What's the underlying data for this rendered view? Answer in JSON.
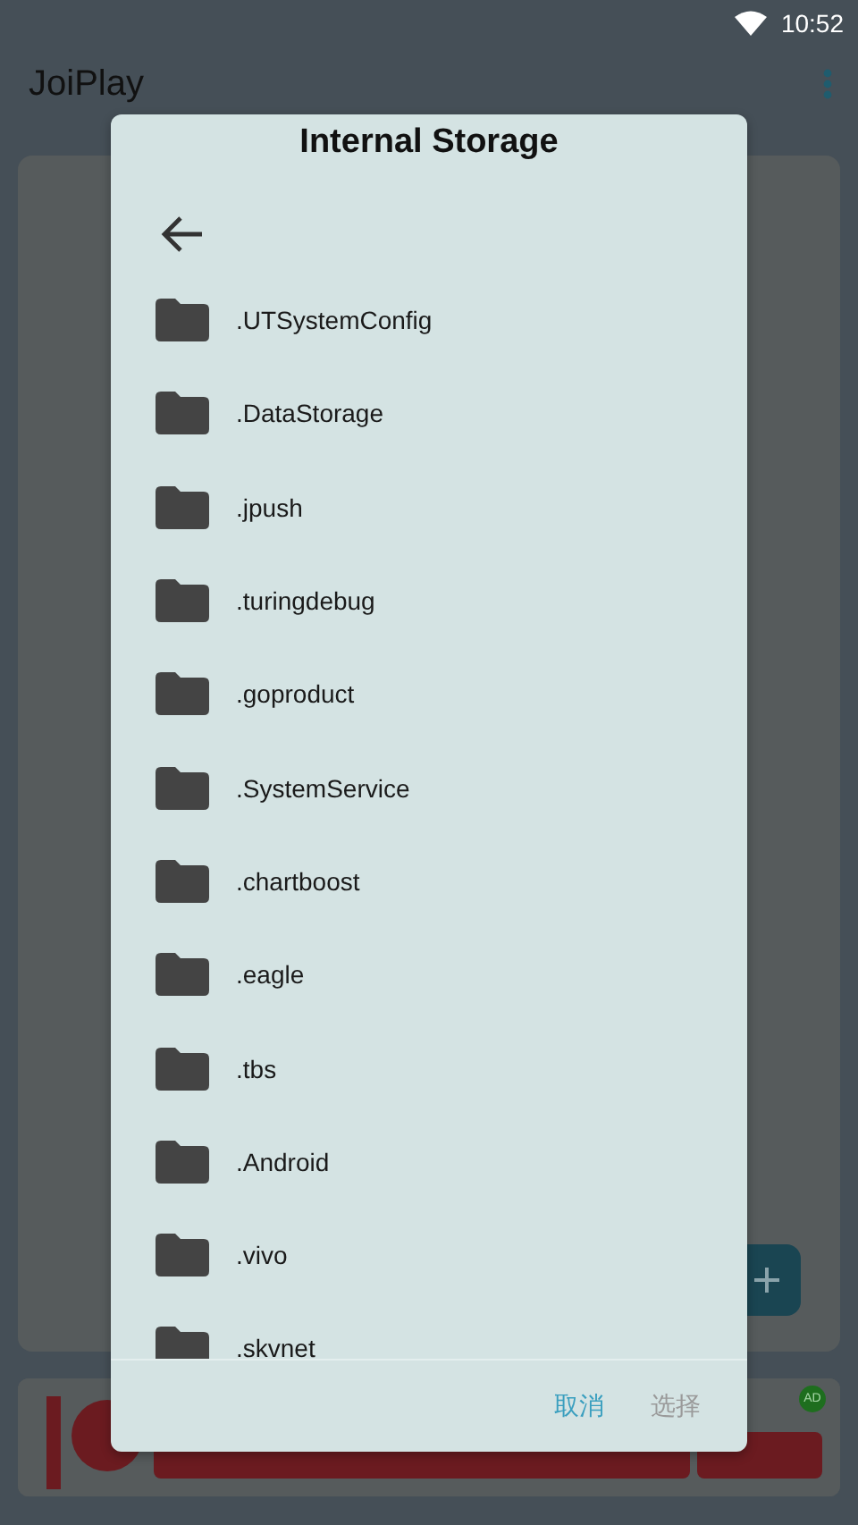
{
  "status_bar": {
    "time": "10:52"
  },
  "app_bar": {
    "title": "JoiPlay"
  },
  "ad_banner": {
    "badge": "AD"
  },
  "dialog": {
    "title": "Internal Storage",
    "folders": [
      {
        "name": ".UTSystemConfig"
      },
      {
        "name": ".DataStorage"
      },
      {
        "name": ".jpush"
      },
      {
        "name": ".turingdebug"
      },
      {
        "name": ".goproduct"
      },
      {
        "name": ".SystemService"
      },
      {
        "name": ".chartboost"
      },
      {
        "name": ".eagle"
      },
      {
        "name": ".tbs"
      },
      {
        "name": ".Android"
      },
      {
        "name": ".vivo"
      },
      {
        "name": ".skvnet"
      }
    ],
    "buttons": [
      {
        "label": "取消",
        "disabled": false
      },
      {
        "label": "选择",
        "disabled": true
      }
    ]
  }
}
